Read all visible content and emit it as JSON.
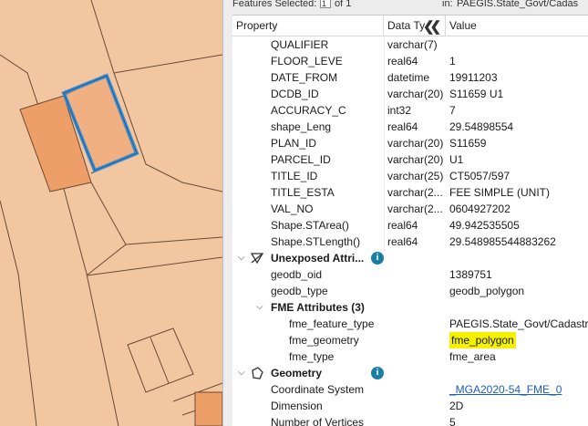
{
  "topbar": {
    "prefix": "Features Selected:",
    "stepper": "1",
    "of": "of 1",
    "in_label": "in:",
    "table_name": "PAEGIS.State_Govt/Cadas"
  },
  "header": {
    "property": "Property",
    "data_type": "Data Ty",
    "value": "Value",
    "collapse_glyph": "❮❮"
  },
  "rows": [
    {
      "p": "QUALIFIER",
      "t": "varchar(7)",
      "v": ""
    },
    {
      "p": "FLOOR_LEVE",
      "t": "real64",
      "v": "1"
    },
    {
      "p": "DATE_FROM",
      "t": "datetime",
      "v": "19911203"
    },
    {
      "p": "DCDB_ID",
      "t": "varchar(20)",
      "v": "S11659   U1"
    },
    {
      "p": "ACCURACY_C",
      "t": "int32",
      "v": "7"
    },
    {
      "p": "shape_Leng",
      "t": "real64",
      "v": "29.54898554"
    },
    {
      "p": "PLAN_ID",
      "t": "varchar(20)",
      "v": "S11659"
    },
    {
      "p": "PARCEL_ID",
      "t": "varchar(20)",
      "v": "U1"
    },
    {
      "p": "TITLE_ID",
      "t": "varchar(25)",
      "v": "CT5057/597"
    },
    {
      "p": "TITLE_ESTA",
      "t": "varchar(2...",
      "v": "FEE SIMPLE (UNIT)"
    },
    {
      "p": "VAL_NO",
      "t": "varchar(2...",
      "v": "0604927202"
    },
    {
      "p": "Shape.STArea()",
      "t": "real64",
      "v": "49.942535505"
    },
    {
      "p": "Shape.STLength()",
      "t": "real64",
      "v": "29.548985544883262"
    }
  ],
  "unexposed": {
    "title": "Unexposed Attri...",
    "info": "i",
    "rows": [
      {
        "p": "geodb_oid",
        "v": "1389751"
      },
      {
        "p": "geodb_type",
        "v": "geodb_polygon"
      }
    ]
  },
  "fme_attributes": {
    "title": "FME Attributes (3)",
    "rows": [
      {
        "p": "fme_feature_type",
        "v": "PAEGIS.State_Govt/Cadastre"
      },
      {
        "p": "fme_geometry",
        "v": "fme_polygon"
      },
      {
        "p": "fme_type",
        "v": "fme_area"
      }
    ]
  },
  "geometry": {
    "title": "Geometry",
    "info": "i",
    "rows": [
      {
        "p": "Coordinate System",
        "v": "_MGA2020-54_FME_0"
      },
      {
        "p": "Dimension",
        "v": "2D"
      },
      {
        "p": "Number of Vertices",
        "v": "5"
      }
    ]
  },
  "colors": {
    "map_fill": "#f2c6a0",
    "selection": "#3d8fd1",
    "info": "#1a7ea5",
    "highlight": "#f5f200"
  }
}
